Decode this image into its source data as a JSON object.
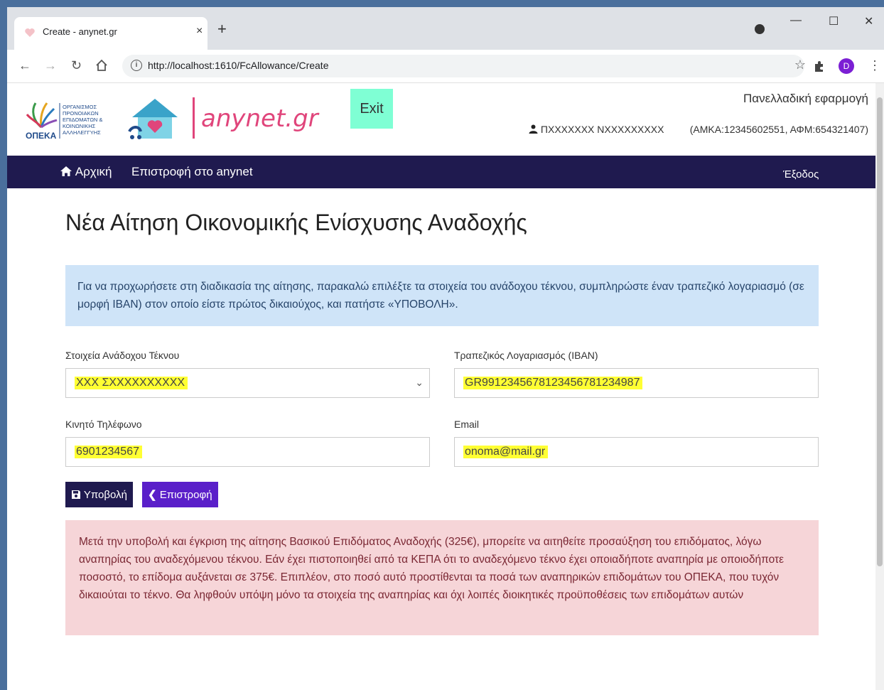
{
  "browser": {
    "tab_title": "Create - anynet.gr",
    "tab_close": "×",
    "new_tab": "+",
    "url": "http://localhost:1610/FcAllowance/Create",
    "minimize": "—",
    "maximize": "☐",
    "close": "✕",
    "profile_initial": "D"
  },
  "header": {
    "brand_text": "anynet.gr",
    "exit_label": "Exit",
    "app_name": "Πανελλαδική εφαρμογή",
    "user_name": "ΠΧΧΧΧΧΧΧ ΝΧΧΧΧΧΧΧΧΧ",
    "user_ids": "(ΑΜΚΑ:12345602551, ΑΦΜ:654321407)"
  },
  "nav": {
    "home_label": "Αρχική",
    "back_label": "Επιστροφή στο anynet",
    "logout_label": "Έξοδος"
  },
  "page": {
    "title": "Νέα Αίτηση Οικονομικής Ενίσχυσης Αναδοχής",
    "info_text": "Για να προχωρήσετε στη διαδικασία της αίτησης, παρακαλώ επιλέξτε τα στοιχεία του ανάδοχου τέκνου, συμπληρώστε έναν τραπεζικό λογαριασμό (σε μορφή IBAN) στον οποίο είστε πρώτος δικαιούχος, και πατήστε «ΥΠΟΒΟΛΗ»."
  },
  "form": {
    "child_label": "Στοιχεία Ανάδοχου Τέκνου",
    "child_value": "ΧΧΧ ΣΧΧΧΧΧΧΧΧΧΧ",
    "iban_label": "Τραπεζικός Λογαριασμός (IBAN)",
    "iban_value": "GR9912345678123456781234987",
    "phone_label": "Κινητό Τηλέφωνο",
    "phone_value": "6901234567",
    "email_label": "Email",
    "email_value": "onoma@mail.gr",
    "submit_label": "Υποβολή",
    "back_label": "Επιστροφή"
  },
  "notice": {
    "text": "Μετά την υποβολή και έγκριση της αίτησης Βασικού Επιδόματος Αναδοχής (325€), μπορείτε να αιτηθείτε προσαύξηση του επιδόματος, λόγω αναπηρίας του αναδεχόμενου τέκνου. Εάν έχει πιστοποιηθεί από τα ΚΕΠΑ ότι το αναδεχόμενο τέκνο έχει οποιαδήποτε αναπηρία με οποιοδήποτε ποσοστό, το επίδομα αυξάνεται σε 375€. Επιπλέον, στο ποσό αυτό προστίθενται τα ποσά των αναπηρικών επιδομάτων του ΟΠΕΚΑ, που τυχόν δικαιούται το τέκνο. Θα ληφθούν υπόψη μόνο τα στοιχεία της αναπηρίας και όχι λοιπές διοικητικές προϋποθέσεις των επιδομάτων αυτών"
  },
  "logo": {
    "opeka_abbr": "ΟΠΕΚΑ",
    "opeka_full": [
      "ΟΡΓΑΝΙΣΜΟΣ",
      "ΠΡΟΝΟΙΑΚΩΝ",
      "ΕΠΙΔΟΜΑΤΩΝ &",
      "ΚΟΙΝΩΝΙΚΗΣ",
      "ΑΛΛΗΛΕΓΓΥΗΣ"
    ]
  },
  "colors": {
    "nav_bg": "#1f1a4f",
    "exit_bg": "#7fffd4",
    "brand": "#e0457b",
    "submit_bg": "#1f1a4f",
    "back_bg": "#5a1fc9",
    "highlight": "#ffff33"
  }
}
